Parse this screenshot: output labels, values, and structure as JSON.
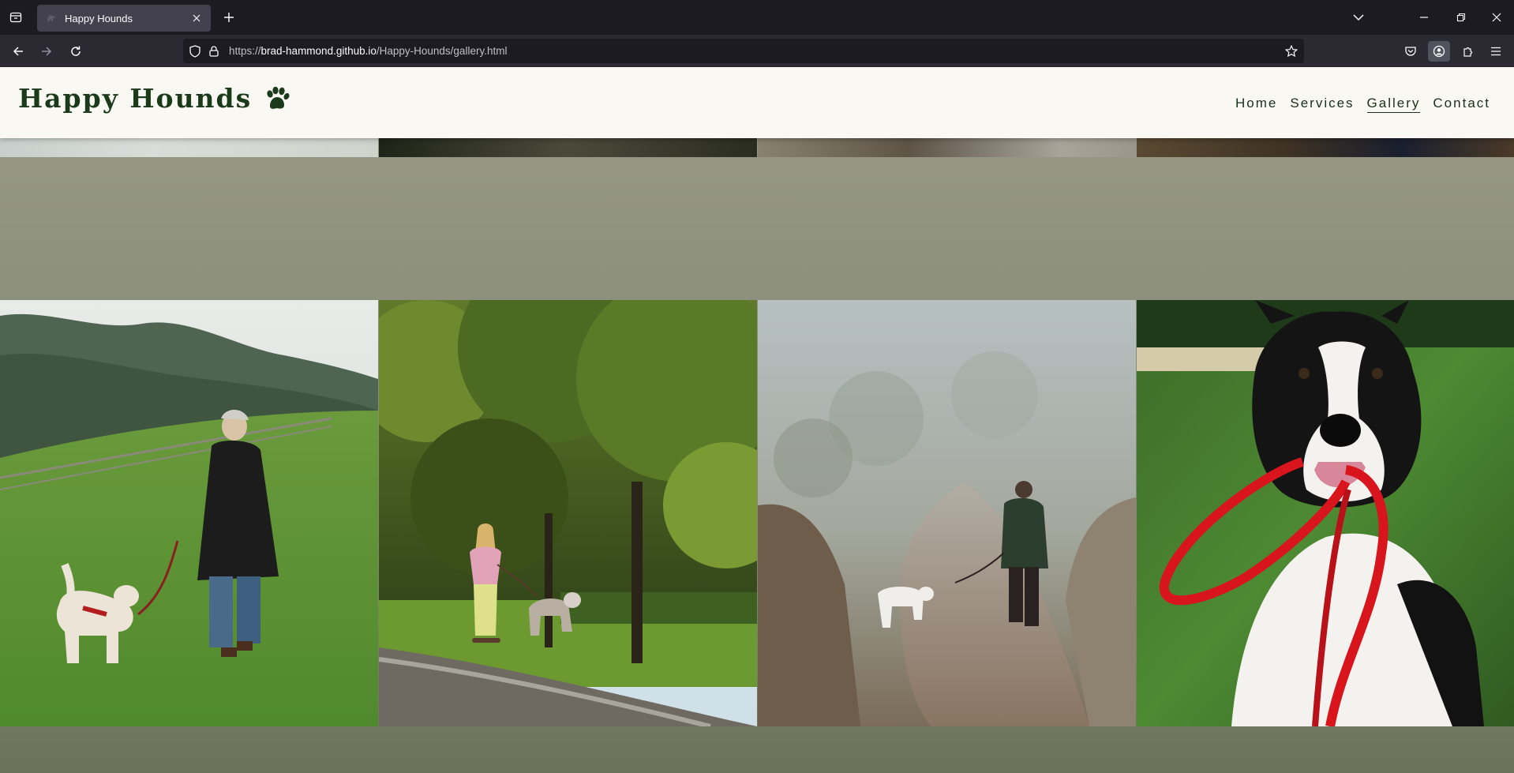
{
  "browser": {
    "tab_title": "Happy Hounds",
    "url_scheme": "https://",
    "url_host": "brad-hammond.github.io",
    "url_path": "/Happy-Hounds/gallery.html"
  },
  "site": {
    "brand": "Happy Hounds",
    "nav": [
      "Home",
      "Services",
      "Gallery",
      "Contact"
    ],
    "current_nav": "Gallery"
  },
  "gallery": {
    "photos": [
      "woman-walking-labrador-on-hill",
      "girl-skateboarding-with-husky-in-park",
      "person-walking-dog-on-foggy-path",
      "border-collie-holding-red-leash"
    ]
  },
  "colors": {
    "header_bg": "#f9f8f3",
    "brand_green": "#1b3a1a",
    "page_bg": "#8f937f"
  }
}
